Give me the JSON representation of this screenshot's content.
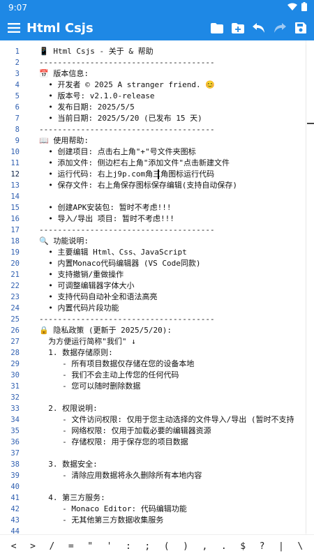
{
  "status_bar": {
    "time": "9:07"
  },
  "app_bar": {
    "title": "Html Csjs",
    "actions": [
      "folder-icon",
      "new-folder-icon",
      "undo-icon",
      "redo-icon",
      "save-icon"
    ]
  },
  "colors": {
    "accent": "#1e88e5",
    "line_number": "#2f5fb0",
    "text": "#111111"
  },
  "editor": {
    "current_line": 12,
    "line_numbers": [
      "1",
      "2",
      "3",
      "4",
      "5",
      "6",
      "7",
      "8",
      "9",
      "10",
      "11",
      "12",
      "13",
      "14",
      "15",
      "16",
      "17",
      "18",
      "19",
      "20",
      "21",
      "22",
      "23",
      "24",
      "25",
      "26",
      "27",
      "28",
      "29",
      "30",
      "31",
      "32",
      "33",
      "34",
      "35",
      "36",
      "37",
      "38",
      "39",
      "40",
      "41",
      "42",
      "43",
      "44"
    ],
    "lines": [
      "📱 Html Csjs - 关于 & 帮助",
      "--------------------------------------",
      "📅 版本信息:",
      "  • 开发者 © 2025 A stranger friend. 😊",
      "  • 版本号: v2.1.0-release",
      "  • 发布日期: 2025/5/5",
      "  • 当前日期: 2025/5/20 (已发布 15 天)",
      "--------------------------------------",
      "📖 使用帮助:",
      "  • 创建项目: 点击右上角\"+\"号文件夹图标",
      "  • 添加文件: 侧边栏右上角\"添加文件\"点击新建文件",
      "  • 运行代码: 右上j9p.com角三角图标运行代码",
      "  • 保存文件: 右上角保存图标保存编辑(支持自动保存)",
      "",
      "  • 创建APK安装包: 暂时不考虑!!!",
      "  • 导入/导出 项目: 暂时不考虑!!!",
      "--------------------------------------",
      "🔍 功能说明:",
      "  • 主要编辑 Html、Css、JavaScript",
      "  • 内置Monaco代码编辑器 (VS Code同款)",
      "  • 支持撤销/重做操作",
      "  • 可调整编辑器字体大小",
      "  • 支持代码自动补全和语法高亮",
      "  • 内置代码片段功能",
      "--------------------------------------",
      "🔒 隐私政策 (更新于 2025/5/20):",
      "  为方便运行简称\"我们\" ↓",
      "  1. 数据存储原则:",
      "     - 所有项目数据仅存储在您的设备本地",
      "     - 我们不会主动上传您的任何代码",
      "     - 您可以随时删除数据",
      "",
      "  2. 权限说明:",
      "     - 文件访问权限: 仅用于您主动选择的文件导入/导出 (暂时不支持",
      "     - 网络权限: 仅用于加载必要的编辑器资源",
      "     - 存储权限: 用于保存您的项目数据",
      "",
      "  3. 数据安全:",
      "     - 清除应用数据将永久删除所有本地内容",
      "",
      "  4. 第三方服务:",
      "     - Monaco Editor: 代码编辑功能",
      "     - 无其他第三方数据收集服务",
      ""
    ]
  },
  "symbol_bar": {
    "keys": [
      "<",
      ">",
      "/",
      "=",
      "\"",
      "'",
      ":",
      ";",
      "(",
      ")",
      ",",
      ".",
      "$",
      "?",
      "|",
      "\\"
    ]
  }
}
